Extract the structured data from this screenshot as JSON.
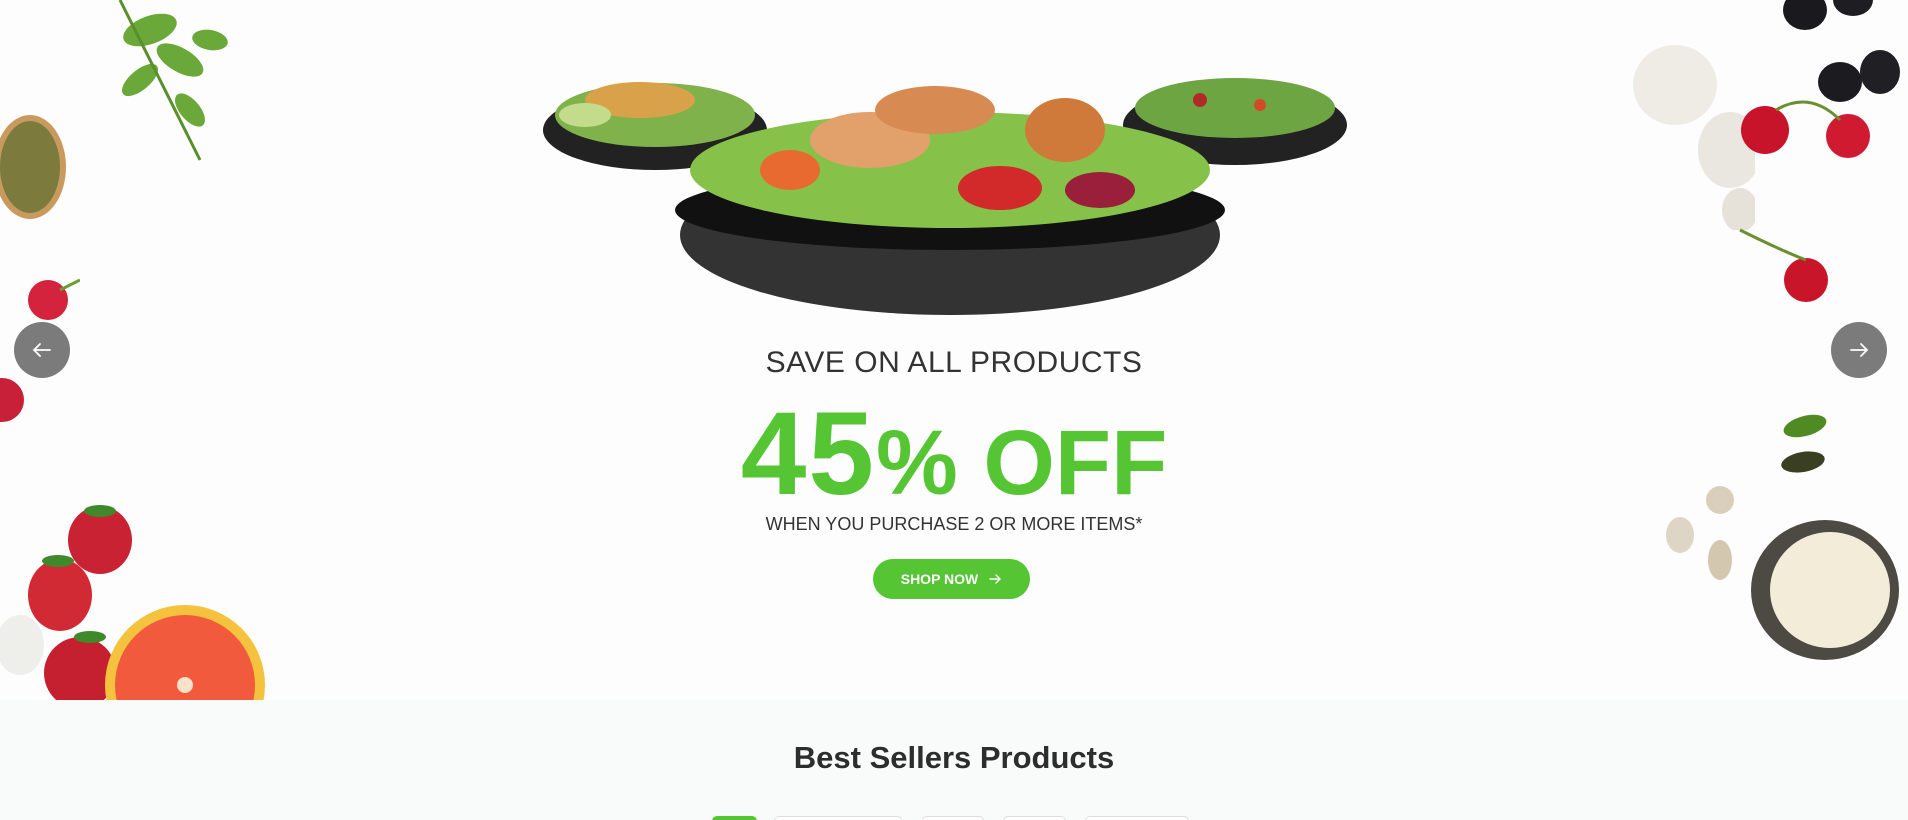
{
  "hero": {
    "eyebrow": "SAVE ON ALL PRODUCTS",
    "discount_number": "45",
    "discount_rest": "% OFF",
    "condition": "WHEN YOU PURCHASE 2 OR MORE ITEMS*",
    "cta_label": "SHOP NOW",
    "prev_icon": "arrow-left-icon",
    "next_icon": "arrow-right-icon"
  },
  "best_sellers": {
    "title": "Best Sellers Products",
    "tab_count": 5
  },
  "colors": {
    "accent": "#56c534",
    "text_dark": "#333333",
    "nav_arrow_bg": "#7a7b7a"
  }
}
